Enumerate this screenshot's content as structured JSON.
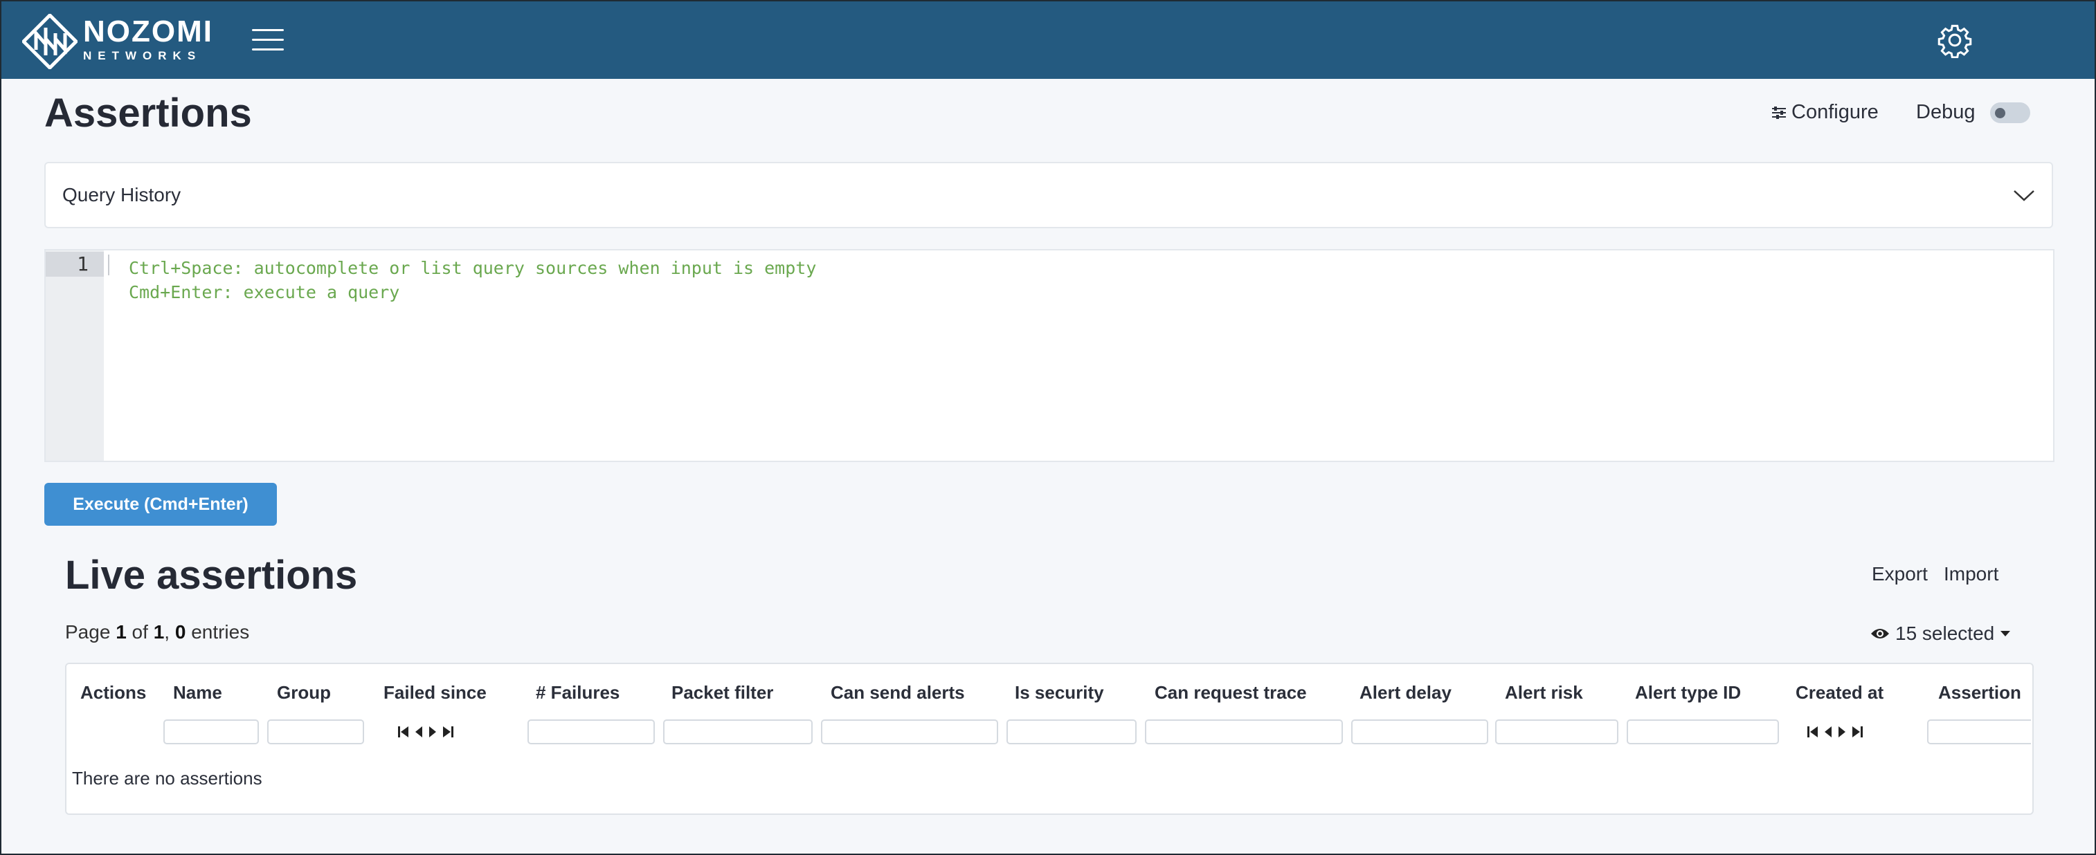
{
  "brand": {
    "name": "NOZOMI",
    "sub": "NETWORKS"
  },
  "header": {
    "title": "Assertions",
    "configure_label": "Configure",
    "debug_label": "Debug"
  },
  "query_history": {
    "label": "Query History"
  },
  "editor": {
    "line_number": "1",
    "hint_line1": "Ctrl+Space: autocomplete or list query sources when input is empty",
    "hint_line2": "Cmd+Enter: execute a query"
  },
  "execute_button": "Execute (Cmd+Enter)",
  "live": {
    "title": "Live assertions",
    "export_label": "Export",
    "import_label": "Import",
    "page_word": "Page",
    "page_current": "1",
    "of_word": "of",
    "page_total": "1",
    "entries_count": "0",
    "entries_word": "entries",
    "selected_label": "15 selected"
  },
  "table": {
    "columns": [
      "Actions",
      "Name",
      "Group",
      "Failed since",
      "# Failures",
      "Packet filter",
      "Can send alerts",
      "Is security",
      "Can request trace",
      "Alert delay",
      "Alert risk",
      "Alert type ID",
      "Created at",
      "Assertion"
    ],
    "empty_message": "There are no assertions"
  },
  "colors": {
    "topbar": "#245a80",
    "primary_button": "#3f8fd2",
    "code_hint": "#6aa84f"
  },
  "icons": [
    "hamburger-menu-icon",
    "gear-icon",
    "sliders-icon",
    "chevron-down-icon",
    "eye-icon",
    "caret-down-icon",
    "first-page-icon",
    "prev-page-icon",
    "next-page-icon",
    "last-page-icon"
  ]
}
